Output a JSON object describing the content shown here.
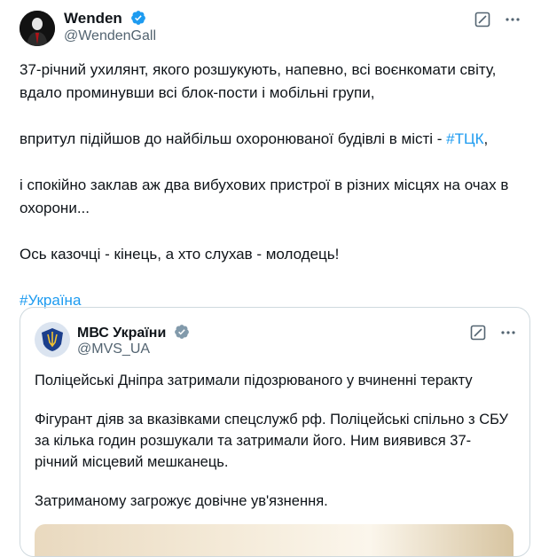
{
  "author": {
    "name": "Wenden",
    "handle": "@WendenGall"
  },
  "tweet": {
    "line1": "37-річний ухилянт, якого розшукують, напевно, всі воєнкомати світу, вдало проминувши всі блок-пости і мобільні групи,",
    "line2_text": "впритул підійшов до найбільш охоронюваної будівлі в місті - ",
    "line2_tag": "#ТЦК",
    "line2_end": ",",
    "line3": "і спокійно заклав аж два вибухових пристрої в різних місцях на очах в охорони...",
    "line4": "Ось казочці - кінець, а хто слухав - молодець!",
    "hashtag": "#Україна"
  },
  "quote": {
    "name": "МВС України",
    "handle": "@MVS_UA",
    "p1": "Поліцейські Дніпра затримали підозрюваного у вчиненні теракту",
    "p2": "Фігурант діяв за вказівками спецслужб рф. Поліцейські спільно з СБУ за кілька годин розшукали та затримали його. Ним виявився 37-річний місцевий мешканець.",
    "p3": "Затриманому загрожує довічне ув'язнення."
  },
  "colors": {
    "accent": "#1d9bf0",
    "secondary_text": "#536471",
    "verified_gray": "#829aab"
  },
  "icons": [
    "verified-badge-icon",
    "grok-icon",
    "more-icon",
    "police-emblem-icon"
  ]
}
